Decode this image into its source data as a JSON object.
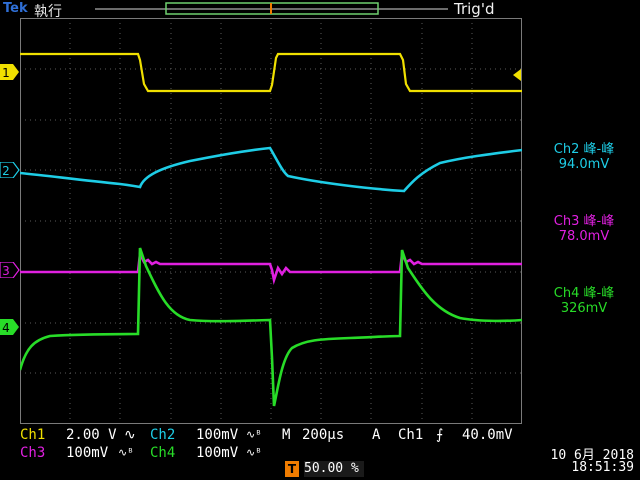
{
  "header": {
    "brand": "Tek",
    "status": "執行",
    "trig_status": "Trig'd"
  },
  "marker": {
    "trigger_symbol": "T"
  },
  "channels": [
    {
      "id": "1",
      "color": "#f0e000"
    },
    {
      "id": "2",
      "color": "#1ecde6"
    },
    {
      "id": "3",
      "color": "#e020e0"
    },
    {
      "id": "4",
      "color": "#28dc28"
    }
  ],
  "measurements": [
    {
      "title": "Ch2 峰-峰",
      "value": "94.0mV",
      "color": "#1ecde6"
    },
    {
      "title": "Ch3 峰-峰",
      "value": "78.0mV",
      "color": "#e020e0"
    },
    {
      "title": "Ch4 峰-峰",
      "value": "326mV",
      "color": "#28dc28"
    }
  ],
  "bottom": {
    "ch1_label": "Ch1",
    "ch1_scale": "2.00 V",
    "ch2_label": "Ch2",
    "ch2_scale": "100mV",
    "ch3_label": "Ch3",
    "ch3_scale": "100mV",
    "ch4_label": "Ch4",
    "ch4_scale": "100mV",
    "m_label": "M",
    "timebase": "200μs",
    "trigger_mode": "A",
    "trigger_source": "Ch1",
    "trigger_level": "40.0mV",
    "trigger_position": "50.00 %",
    "date": "10 6月 2018",
    "time": "18:51:39"
  },
  "icons": {
    "coupling": "sine-icon",
    "bandwidth": "bw-icon",
    "slope": "rising-edge-icon"
  }
}
